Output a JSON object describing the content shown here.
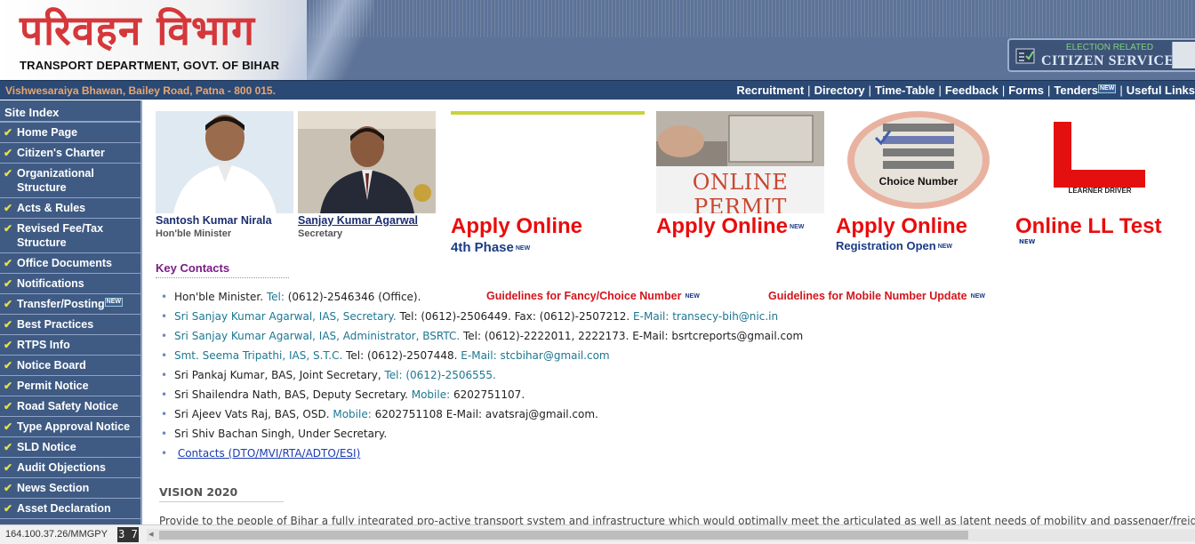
{
  "header": {
    "hindi_title": "परिवहन विभाग",
    "english_title": "TRANSPORT DEPARTMENT, GOVT. OF BIHAR",
    "citizen_small": "ELECTION RELATED",
    "citizen_big": "CITIZEN SERVICES"
  },
  "navbar": {
    "address": "Vishwesaraiya Bhawan, Bailey Road, Patna - 800 015.",
    "links": [
      "Recruitment",
      "Directory",
      "Time-Table",
      "Feedback",
      "Forms",
      "Tenders",
      "Useful Links"
    ],
    "new_badge": "NEW"
  },
  "sidebar": {
    "title": "Site Index",
    "items": [
      "Home Page",
      "Citizen's Charter",
      "Organizational Structure",
      "Acts & Rules",
      "Revised Fee/Tax Structure",
      "Office Documents",
      "Notifications",
      "Transfer/Posting",
      "Best Practices",
      "RTPS Info",
      "Notice Board",
      "Permit Notice",
      "Road Safety Notice",
      "Type Approval Notice",
      "SLD Notice",
      "Audit Objections",
      "News Section",
      "Asset Declaration"
    ]
  },
  "people": {
    "minister_name": "Santosh Kumar Nirala",
    "minister_title": "Hon'ble Minister",
    "secretary_name": "Sanjay Kumar Agarwal",
    "secretary_title": "Secretary"
  },
  "banners": {
    "online_permit_img": "ONLINE PERMIT",
    "choice_img": "Choice Number",
    "learner_img": "LEARNER DRIVER",
    "apply1": "Apply Online",
    "apply1_sub": "4th Phase",
    "apply2": "Apply Online",
    "apply3": "Apply Online",
    "apply3_sub": "Registration Open",
    "ll_test": "Online LL Test",
    "new": "NEW"
  },
  "key_contacts": {
    "title": "Key Contacts",
    "guide1": "Guidelines for Fancy/Choice Number",
    "guide2": "Guidelines for Mobile Number Update",
    "rows": [
      {
        "a": "Hon'ble Minister. ",
        "b": "Tel:",
        "c": " (0612)-2546346 (Office)."
      },
      {
        "a": "Sri Sanjay Kumar Agarwal, IAS, Secretary.",
        "b": " Tel: (0612)-2506449. Fax: (0612)-2507212.",
        "c": " E-Mail: transecy-bih@nic.in"
      },
      {
        "a": "Sri Sanjay Kumar Agarwal, IAS, Administrator, BSRTC.",
        "b": " Tel: (0612)-2222011, 2222173.",
        "c": " E-Mail: bsrtcreports@gmail.com"
      },
      {
        "a": "Smt. Seema Tripathi, IAS, S.T.C.",
        "b": " Tel: (0612)-2507448.",
        "c": "  E-Mail: stcbihar@gmail.com"
      },
      {
        "a": "Sri Pankaj Kumar, BAS, Joint Secretary,",
        "b": " Tel: (0612)-2506555.",
        "c": ""
      },
      {
        "a": "Sri Shailendra Nath, BAS, Deputy Secretary.",
        "b": " Mobile:",
        "c": " 6202751107."
      },
      {
        "a": "Sri Ajeev Vats Raj, BAS, OSD.",
        "b": " Mobile:",
        "c": " 6202751108 E-Mail: avatsraj@gmail.com."
      },
      {
        "a": "Sri Shiv Bachan Singh, Under Secretary.",
        "b": "",
        "c": ""
      }
    ],
    "contacts_link": "Contacts (DTO/MVI/RTA/ADTO/ESI)"
  },
  "vision": {
    "title": "VISION 2020",
    "text": "Provide to the people of Bihar a fully integrated pro-active transport system and infrastructure which would optimally meet the articulated as well as latent needs of mobility and passenger/freight"
  },
  "status": {
    "url": "164.100.37.26/MMGPY",
    "counter": "3 7"
  }
}
